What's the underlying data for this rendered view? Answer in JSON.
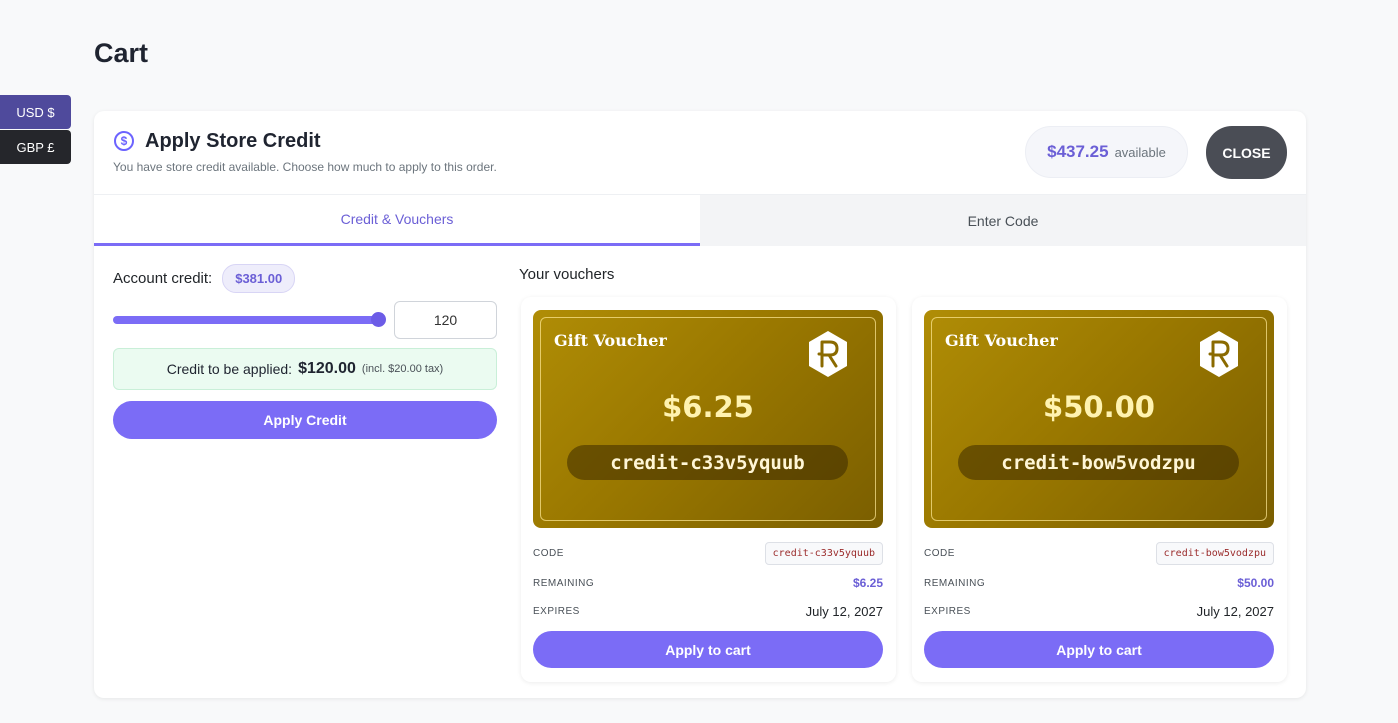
{
  "page": {
    "title": "Cart"
  },
  "currency": {
    "usd_label": "USD $",
    "gbp_label": "GBP £"
  },
  "store_credit": {
    "icon": "dollar-circle-icon",
    "title": "Apply Store Credit",
    "subtitle": "You have store credit available. Choose how much to apply to this order.",
    "available_amount": "$437.25",
    "available_label": "available",
    "close_label": "CLOSE"
  },
  "tabs": [
    {
      "label": "Credit & Vouchers",
      "active": true
    },
    {
      "label": "Enter Code",
      "active": false
    }
  ],
  "account": {
    "label": "Account credit:",
    "balance": "$381.00",
    "slider_value": 120,
    "slider_max": 120,
    "input_value": "120",
    "applied_label": "Credit to be applied:",
    "applied_amount": "$120.00",
    "applied_tax": "(incl. $20.00 tax)",
    "apply_button": "Apply Credit"
  },
  "vouchers": {
    "title": "Your vouchers",
    "items": [
      {
        "image_title": "Gift Voucher",
        "amount": "$6.25",
        "code": "credit-c33v5yquub",
        "code_label": "CODE",
        "remaining_label": "REMAINING",
        "remaining": "$6.25",
        "expires_label": "EXPIRES",
        "expires": "July 12, 2027",
        "button": "Apply to cart"
      },
      {
        "image_title": "Gift Voucher",
        "amount": "$50.00",
        "code": "credit-bow5vodzpu",
        "code_label": "CODE",
        "remaining_label": "REMAINING",
        "remaining": "$50.00",
        "expires_label": "EXPIRES",
        "expires": "July 12, 2027",
        "button": "Apply to cart"
      }
    ]
  },
  "colors": {
    "accent": "#7b6cf6",
    "accent_text": "#6b5fd6",
    "voucher_gold": "#9a7800",
    "close_button": "#4a4d55"
  }
}
